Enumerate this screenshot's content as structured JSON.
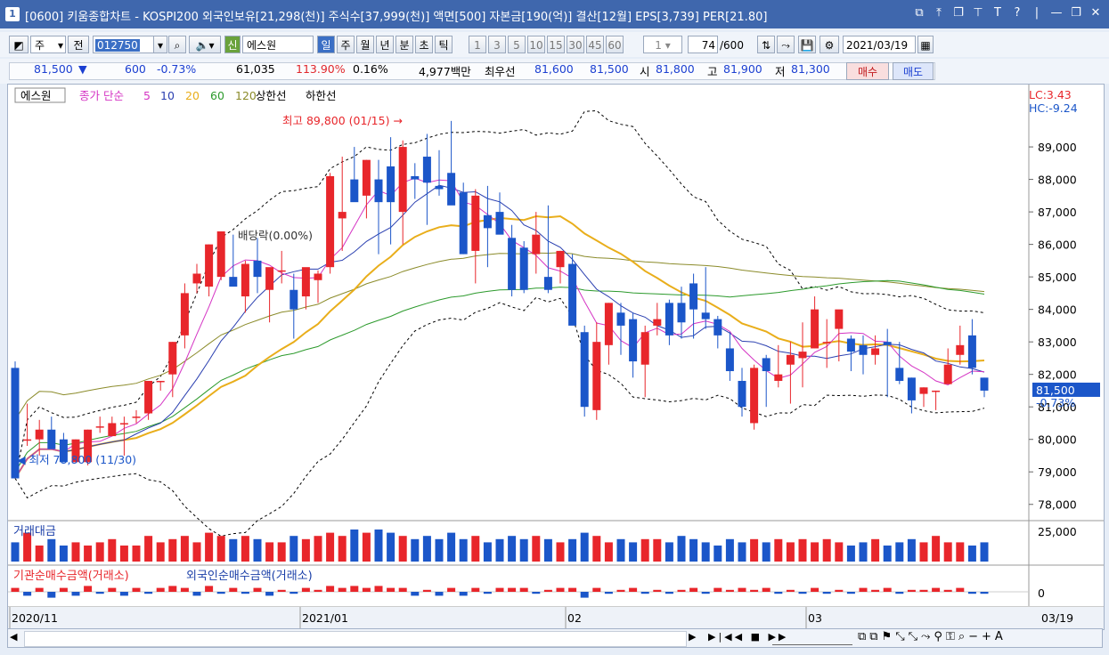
{
  "title": {
    "window_no": "1",
    "text": "[0600] 키움종합차트 - KOSPI200 외국인보유[21,298(천)] 주식수[37,999(천)] 액면[500] 자본금[190(억)] 결산[12월] EPS[3,739] PER[21.80]"
  },
  "toolbar": {
    "market": "주",
    "prev": "전",
    "code": "012750",
    "sin_badge": "신",
    "stock_name": "에스원",
    "periods": [
      "일",
      "주",
      "월",
      "년",
      "분",
      "초",
      "틱"
    ],
    "active_period": "일",
    "intervals": [
      "1",
      "3",
      "5",
      "10",
      "15",
      "30",
      "45",
      "60"
    ],
    "unit": "1",
    "count": "74",
    "count_total": "/600",
    "date": "2021/03/19"
  },
  "quote": {
    "price": "81,500",
    "arrow": "▼",
    "change": "600",
    "change_pct": "-0.73%",
    "volume": "61,035",
    "vol_ratio": "113.90%",
    "turnover": "0.16%",
    "amount": "4,977백만",
    "best_label": "최우선",
    "ask": "81,600",
    "bid": "81,500",
    "open_label": "시",
    "open": "81,800",
    "high_label": "고",
    "high": "81,900",
    "low_label": "저",
    "low": "81,300",
    "buy": "매수",
    "sell": "매도"
  },
  "legend": {
    "name": "에스원",
    "close_label": "종가 단순",
    "ma": [
      "5",
      "10",
      "20",
      "60",
      "120"
    ],
    "upper": "상한선",
    "lower": "하한선"
  },
  "colors": {
    "up": "#e8262b",
    "down": "#1b56c9",
    "ma5": "#d535c4",
    "ma10": "#2a3fb0",
    "ma20": "#e9ae1b",
    "ma60": "#2c9a2c",
    "ma120": "#8b8b2a",
    "bands": "#000000"
  },
  "annotations": {
    "high": "최고 89,800 (01/15)",
    "low": "최저 78,800 (11/30)",
    "dividend": "배당락(0.00%)",
    "lc": "LC:3.43",
    "hc": "HC:-9.24",
    "last_price": "81,500",
    "last_pct": "-0.73%"
  },
  "volume_panel": {
    "title": "거래대금",
    "ref": "25,000"
  },
  "flow_panel": {
    "title1": "기관순매수금액(거래소)",
    "title2": "외국인순매수금액(거래소)",
    "zero": "0"
  },
  "x_labels": [
    "2020/11",
    "2021/01",
    "02",
    "03",
    "03/19"
  ],
  "chart_data": {
    "type": "candlestick",
    "y_ticks": [
      "89,000",
      "88,000",
      "87,000",
      "86,000",
      "85,000",
      "84,000",
      "83,000",
      "82,000",
      "81,000",
      "80,000",
      "79,000",
      "78,000"
    ],
    "ylim": [
      77500,
      90700
    ],
    "candles": [
      [
        82200,
        82400,
        78800,
        78800
      ],
      [
        80000,
        81100,
        79800,
        80000
      ],
      [
        80000,
        80600,
        79500,
        80300
      ],
      [
        80300,
        80700,
        79700,
        79700
      ],
      [
        80000,
        80200,
        79300,
        79300
      ],
      [
        79300,
        80000,
        79300,
        80000
      ],
      [
        79300,
        80300,
        79200,
        80300
      ],
      [
        80400,
        80700,
        80200,
        80400
      ],
      [
        80100,
        80700,
        80100,
        80500
      ],
      [
        80500,
        80700,
        79500,
        80500
      ],
      [
        80700,
        80900,
        80500,
        80700
      ],
      [
        80800,
        81800,
        80600,
        81800
      ],
      [
        81800,
        81800,
        81500,
        81800
      ],
      [
        82000,
        83000,
        81300,
        83000
      ],
      [
        83200,
        84800,
        82800,
        84500
      ],
      [
        84800,
        85400,
        84500,
        85100
      ],
      [
        84700,
        86000,
        84400,
        86000
      ],
      [
        85000,
        86400,
        84900,
        86400
      ],
      [
        85000,
        86300,
        84800,
        84700
      ],
      [
        84400,
        85500,
        83900,
        85400
      ],
      [
        85500,
        86200,
        84500,
        85000
      ],
      [
        84600,
        85100,
        83600,
        85300
      ],
      [
        85200,
        85800,
        84800,
        85200
      ],
      [
        84600,
        85100,
        83100,
        84000
      ],
      [
        84400,
        85200,
        84000,
        85300
      ],
      [
        84900,
        85200,
        84200,
        85100
      ],
      [
        85300,
        88200,
        85100,
        88100
      ],
      [
        86800,
        88700,
        85800,
        87000
      ],
      [
        88000,
        89000,
        87500,
        87300
      ],
      [
        87500,
        88600,
        86800,
        88600
      ],
      [
        88000,
        88600,
        85700,
        87300
      ],
      [
        88400,
        89300,
        86000,
        87300
      ],
      [
        87000,
        89200,
        86000,
        89000
      ],
      [
        88100,
        88500,
        87400,
        88000
      ],
      [
        88700,
        89400,
        86600,
        87900
      ],
      [
        87800,
        88900,
        87500,
        87700
      ],
      [
        88200,
        89800,
        87300,
        87200
      ],
      [
        87600,
        87900,
        85700,
        85700
      ],
      [
        85800,
        87700,
        84800,
        87500
      ],
      [
        86900,
        87800,
        85300,
        86500
      ],
      [
        87000,
        87600,
        86700,
        86300
      ],
      [
        86200,
        86600,
        84400,
        84600
      ],
      [
        85900,
        86100,
        84500,
        84600
      ],
      [
        85700,
        87000,
        85100,
        86300
      ],
      [
        85000,
        87200,
        84500,
        84600
      ],
      [
        85300,
        85800,
        84800,
        85800
      ],
      [
        85400,
        85700,
        83900,
        83500
      ],
      [
        83300,
        83500,
        80700,
        81000
      ],
      [
        80900,
        83600,
        80600,
        83000
      ],
      [
        82900,
        84200,
        82300,
        84200
      ],
      [
        83900,
        84200,
        82600,
        83500
      ],
      [
        83700,
        83900,
        81900,
        82400
      ],
      [
        82300,
        83500,
        81300,
        83300
      ],
      [
        83500,
        84200,
        83200,
        83700
      ],
      [
        84200,
        84300,
        82900,
        83200
      ],
      [
        84200,
        84700,
        83100,
        83600
      ],
      [
        84800,
        85100,
        83100,
        84000
      ],
      [
        83900,
        85300,
        83400,
        83700
      ],
      [
        83700,
        83800,
        82800,
        83200
      ],
      [
        82800,
        83300,
        81800,
        82100
      ],
      [
        81800,
        82200,
        80700,
        81000
      ],
      [
        80500,
        82300,
        80300,
        82200
      ],
      [
        82500,
        82600,
        81000,
        82100
      ],
      [
        81800,
        82900,
        81600,
        82000
      ],
      [
        82300,
        83000,
        81100,
        82600
      ],
      [
        82500,
        83600,
        81600,
        82700
      ],
      [
        82800,
        84400,
        82800,
        84000
      ],
      [
        83000,
        83700,
        82200,
        83000
      ],
      [
        83400,
        83900,
        82400,
        84000
      ],
      [
        83100,
        83200,
        82100,
        82700
      ],
      [
        82900,
        83200,
        82000,
        82600
      ],
      [
        82600,
        83200,
        82300,
        82800
      ],
      [
        83000,
        83400,
        81300,
        82900
      ],
      [
        82200,
        83000,
        81700,
        81800
      ],
      [
        81900,
        81900,
        80800,
        81200
      ],
      [
        81400,
        81600,
        81000,
        81600
      ],
      [
        81500,
        81500,
        80900,
        81500
      ],
      [
        81700,
        82800,
        81700,
        82300
      ],
      [
        82600,
        83500,
        82300,
        82900
      ],
      [
        83200,
        83700,
        82000,
        82200
      ],
      [
        81900,
        81900,
        81300,
        81500
      ]
    ],
    "volume": [
      6,
      9,
      5,
      7,
      5,
      6,
      5,
      6,
      7,
      5,
      5,
      8,
      6,
      7,
      8,
      6,
      9,
      8,
      7,
      8,
      7,
      6,
      6,
      8,
      7,
      8,
      9,
      8,
      10,
      9,
      10,
      9,
      8,
      7,
      8,
      7,
      9,
      7,
      8,
      6,
      7,
      8,
      7,
      8,
      7,
      6,
      7,
      9,
      8,
      6,
      7,
      6,
      7,
      7,
      6,
      8,
      7,
      6,
      5,
      7,
      6,
      7,
      6,
      7,
      6,
      7,
      6,
      7,
      6,
      5,
      6,
      7,
      5,
      6,
      7,
      6,
      8,
      6,
      6,
      5,
      6
    ],
    "flow": [
      2,
      -2,
      2,
      -3,
      2,
      -2,
      3,
      -1,
      2,
      -2,
      2,
      -1,
      2,
      3,
      2,
      -2,
      3,
      -1,
      2,
      -1,
      2,
      -2,
      1,
      -1,
      2,
      1,
      3,
      2,
      3,
      2,
      3,
      2,
      2,
      -2,
      1,
      -2,
      2,
      -2,
      2,
      -1,
      2,
      2,
      2,
      -1,
      1,
      2,
      2,
      -3,
      2,
      -1,
      1,
      2,
      -1,
      1,
      -1,
      1,
      2,
      -1,
      2,
      1,
      2,
      1,
      2,
      -1,
      1,
      -1,
      2,
      -1,
      1,
      -1,
      2,
      1,
      2,
      -1,
      1,
      1,
      2,
      1,
      2,
      -1,
      -1
    ]
  }
}
